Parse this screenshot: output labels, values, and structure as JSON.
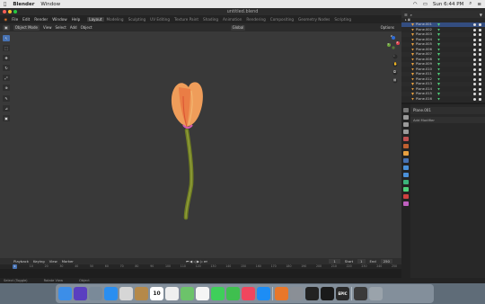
{
  "macos_menubar": {
    "apple": "",
    "app": "Blender",
    "window_menu": "Window",
    "clock": "Sun 6:44 PM"
  },
  "window": {
    "title": "untitled.blend"
  },
  "blender_menu": {
    "items": [
      "File",
      "Edit",
      "Render",
      "Window",
      "Help"
    ],
    "workspaces": [
      "Layout",
      "Modeling",
      "Sculpting",
      "UV Editing",
      "Texture Paint",
      "Shading",
      "Animation",
      "Rendering",
      "Compositing",
      "Geometry Nodes",
      "Scripting"
    ],
    "active_workspace": "Layout",
    "scene": "Scene",
    "view_layer": "ViewLayer"
  },
  "viewport_header": {
    "mode": "Object Mode",
    "menus": [
      "View",
      "Select",
      "Add",
      "Object"
    ],
    "transform": "Global",
    "options": "Options"
  },
  "toolbar": {
    "icons": [
      "cursor-icon",
      "select-box-icon",
      "move-icon",
      "rotate-icon",
      "scale-icon",
      "transform-icon",
      "annotate-icon",
      "measure-icon",
      "add-cube-icon"
    ]
  },
  "nav_gizmo": {
    "axes": [
      "X",
      "Y",
      "Z"
    ]
  },
  "outliner": {
    "rows": [
      "Plane.001",
      "Plane.002",
      "Plane.003",
      "Plane.004",
      "Plane.005",
      "Plane.006",
      "Plane.007",
      "Plane.008",
      "Plane.009",
      "Plane.010",
      "Plane.011",
      "Plane.012",
      "Plane.013",
      "Plane.014",
      "Plane.015",
      "Plane.016"
    ],
    "selected_index": 0
  },
  "properties": {
    "object_name": "Plane.001",
    "modifier_label": "Add Modifier"
  },
  "timeline": {
    "menus": [
      "Playback",
      "Keying",
      "View",
      "Marker"
    ],
    "current_frame": "1",
    "start_label": "Start",
    "start_value": "1",
    "end_label": "End",
    "end_value": "250",
    "ruler": [
      "0",
      "10",
      "20",
      "30",
      "40",
      "50",
      "60",
      "70",
      "80",
      "90",
      "100",
      "110",
      "120",
      "130",
      "140",
      "150",
      "160",
      "170",
      "180",
      "190",
      "200",
      "210",
      "220",
      "230",
      "240",
      "250"
    ]
  },
  "statusbar": {
    "left": "Select (Toggle)",
    "middle": "Rotate View",
    "right": "Object"
  },
  "dock": {
    "apps": [
      {
        "name": "finder-icon",
        "color": "#3c8ee8",
        "glyph": ""
      },
      {
        "name": "siri-icon",
        "color": "#5a3fc0",
        "glyph": ""
      },
      {
        "name": "launchpad-icon",
        "color": "#7a8a99",
        "glyph": ""
      },
      {
        "name": "safari-icon",
        "color": "#2a8ef0",
        "glyph": ""
      },
      {
        "name": "mail-icon",
        "color": "#d6d6d6",
        "glyph": ""
      },
      {
        "name": "notes-icon",
        "color": "#b5894a",
        "glyph": ""
      },
      {
        "name": "calendar-icon",
        "color": "#ffffff",
        "glyph": "10"
      },
      {
        "name": "reminders-icon",
        "color": "#efefef",
        "glyph": ""
      },
      {
        "name": "maps-icon",
        "color": "#6cc36a",
        "glyph": ""
      },
      {
        "name": "photos-icon",
        "color": "#f5f5f5",
        "glyph": ""
      },
      {
        "name": "messages-icon",
        "color": "#3fcf5a",
        "glyph": ""
      },
      {
        "name": "facetime-icon",
        "color": "#3fbf4f",
        "glyph": ""
      },
      {
        "name": "music-icon",
        "color": "#f0465e",
        "glyph": ""
      },
      {
        "name": "app-store-icon",
        "color": "#1d8df5",
        "glyph": ""
      },
      {
        "name": "blender-icon",
        "color": "#e8772a",
        "glyph": ""
      },
      {
        "name": "system-preferences-icon",
        "color": "#8a8f96",
        "glyph": ""
      },
      {
        "name": "unity-icon",
        "color": "#222222",
        "glyph": ""
      },
      {
        "name": "unreal-icon",
        "color": "#1a1a1a",
        "glyph": ""
      },
      {
        "name": "epic-games-icon",
        "color": "#2a2a2a",
        "glyph": "EPIC"
      },
      {
        "name": "downloads-stack-icon",
        "color": "#3a3a3a",
        "glyph": ""
      },
      {
        "name": "trash-icon",
        "color": "#9aa3ab",
        "glyph": ""
      }
    ]
  },
  "colors": {
    "accent": "#4772b3",
    "petal": "#f09a55",
    "stem": "#8a9a2e",
    "viewport": "#393939"
  }
}
